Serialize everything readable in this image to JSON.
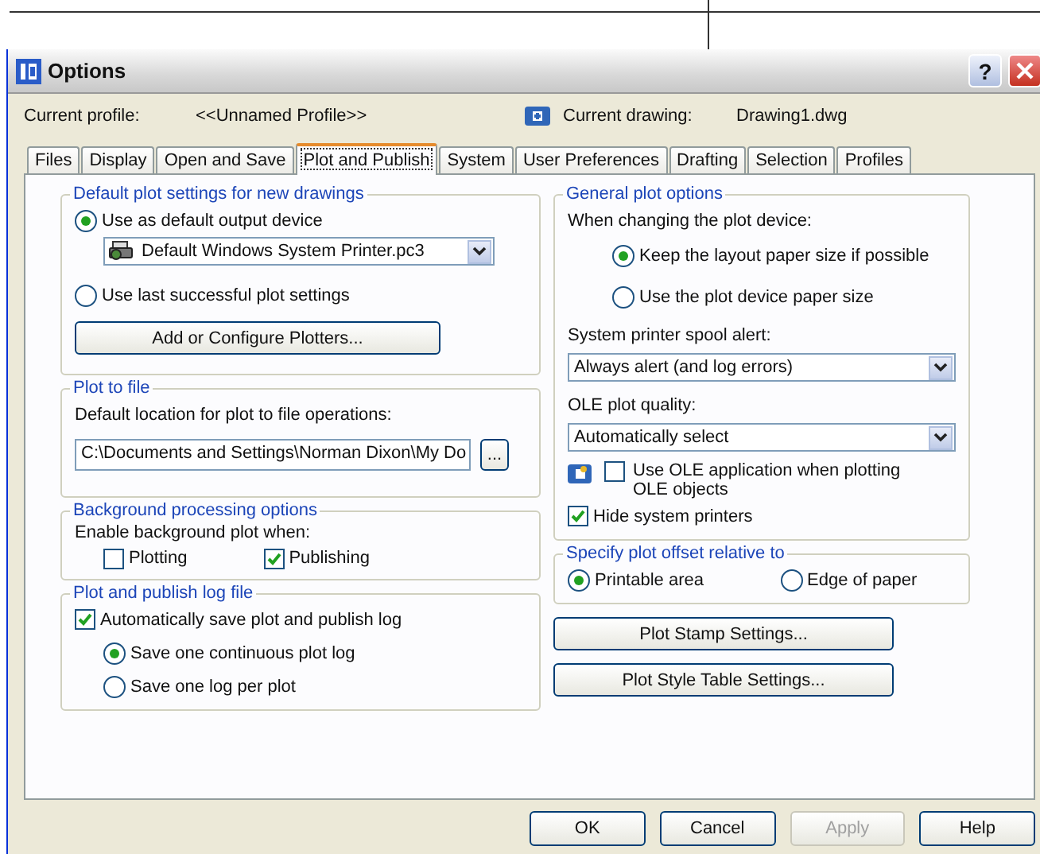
{
  "window": {
    "title": "Options",
    "help_glyph": "?"
  },
  "profile": {
    "label": "Current profile:",
    "value": "<<Unnamed Profile>>",
    "drawing_label": "Current drawing:",
    "drawing_value": "Drawing1.dwg"
  },
  "tabs": [
    {
      "label": "Files",
      "selected": false
    },
    {
      "label": "Display",
      "selected": false
    },
    {
      "label": "Open and Save",
      "selected": false
    },
    {
      "label": "Plot and Publish",
      "selected": true
    },
    {
      "label": "System",
      "selected": false
    },
    {
      "label": "User Preferences",
      "selected": false
    },
    {
      "label": "Drafting",
      "selected": false
    },
    {
      "label": "Selection",
      "selected": false
    },
    {
      "label": "Profiles",
      "selected": false
    }
  ],
  "default_plot": {
    "title": "Default plot settings for new drawings",
    "options": [
      {
        "label": "Use as default output device",
        "selected": true
      },
      {
        "label": "Use last successful plot settings",
        "selected": false
      }
    ],
    "device": "Default Windows System Printer.pc3",
    "button": "Add or Configure Plotters..."
  },
  "plot_to_file": {
    "title": "Plot to file",
    "label": "Default location for plot to file operations:",
    "value": "C:\\Documents and Settings\\Norman Dixon\\My Do",
    "button": "..."
  },
  "background": {
    "title": "Background processing options",
    "label": "Enable background plot when:",
    "checks": [
      {
        "label": "Plotting",
        "checked": false
      },
      {
        "label": "Publishing",
        "checked": true
      }
    ]
  },
  "log": {
    "title": "Plot and publish log file",
    "check": {
      "label": "Automatically save plot and publish log",
      "checked": true
    },
    "options": [
      {
        "label": "Save one continuous plot log",
        "selected": true
      },
      {
        "label": "Save one log per plot",
        "selected": false
      }
    ]
  },
  "general": {
    "title": "General plot options",
    "device_label": "When changing the plot device:",
    "options": [
      {
        "label": "Keep the layout paper size if possible",
        "selected": true
      },
      {
        "label": "Use the plot device paper size",
        "selected": false
      }
    ],
    "spool_label": "System printer spool alert:",
    "spool_value": "Always alert (and log errors)",
    "ole_label": "OLE plot quality:",
    "ole_value": "Automatically select",
    "ole_check": {
      "label": "Use OLE application when plotting OLE objects",
      "checked": false
    },
    "hide_check": {
      "label": "Hide system printers",
      "checked": true
    }
  },
  "offset": {
    "title": "Specify plot offset relative to",
    "options": [
      {
        "label": "Printable area",
        "selected": true
      },
      {
        "label": "Edge of paper",
        "selected": false
      }
    ]
  },
  "side_buttons": [
    "Plot Stamp Settings...",
    "Plot Style Table Settings..."
  ],
  "buttons": [
    {
      "label": "OK",
      "disabled": false
    },
    {
      "label": "Cancel",
      "disabled": false
    },
    {
      "label": "Apply",
      "disabled": true
    },
    {
      "label": "Help",
      "disabled": false
    }
  ]
}
